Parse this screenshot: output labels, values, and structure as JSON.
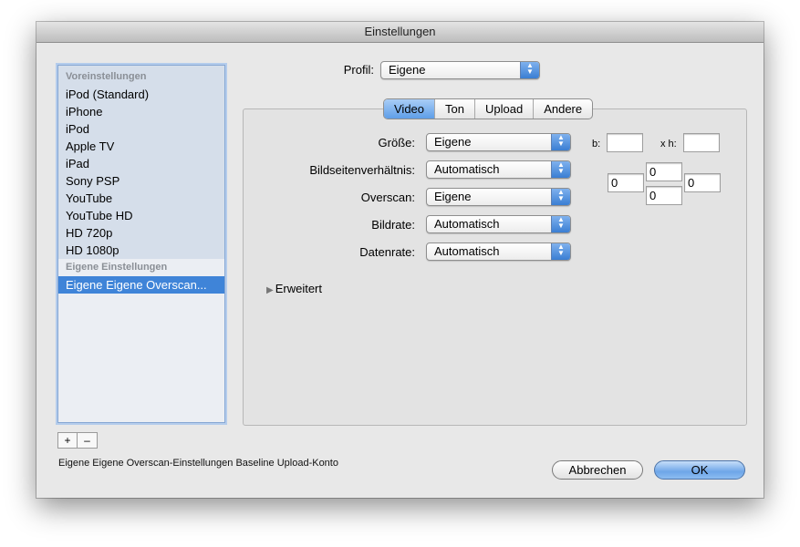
{
  "window": {
    "title": "Einstellungen"
  },
  "sidebar": {
    "header_presets": "Voreinstellungen",
    "presets": [
      "iPod (Standard)",
      "iPhone",
      "iPod",
      "Apple TV",
      "iPad",
      "Sony PSP",
      "YouTube",
      "YouTube HD",
      "HD 720p",
      "HD 1080p"
    ],
    "header_custom": "Eigene Einstellungen",
    "custom": [
      "Eigene Eigene Overscan..."
    ],
    "add_label": "+",
    "remove_label": "–"
  },
  "status": {
    "text": "Eigene Eigene Overscan-Einstellungen Baseline Upload-Konto"
  },
  "profile": {
    "label": "Profil:",
    "value": "Eigene"
  },
  "tabs": [
    {
      "label": "Video",
      "active": true
    },
    {
      "label": "Ton",
      "active": false
    },
    {
      "label": "Upload",
      "active": false
    },
    {
      "label": "Andere",
      "active": false
    }
  ],
  "video": {
    "groesse": {
      "label": "Größe:",
      "value": "Eigene"
    },
    "seitenverhaeltnis": {
      "label": "Bildseitenverhältnis:",
      "value": "Automatisch"
    },
    "overscan": {
      "label": "Overscan:",
      "value": "Eigene"
    },
    "bildrate": {
      "label": "Bildrate:",
      "value": "Automatisch"
    },
    "datenrate": {
      "label": "Datenrate:",
      "value": "Automatisch"
    },
    "size_width_label": "b:",
    "size_width_value": "",
    "size_height_label": "x h:",
    "size_height_value": "",
    "overscan_top": "0",
    "overscan_left": "0",
    "overscan_right": "0",
    "overscan_bottom": "0",
    "advanced_label": "Erweitert"
  },
  "buttons": {
    "cancel": "Abbrechen",
    "ok": "OK"
  }
}
